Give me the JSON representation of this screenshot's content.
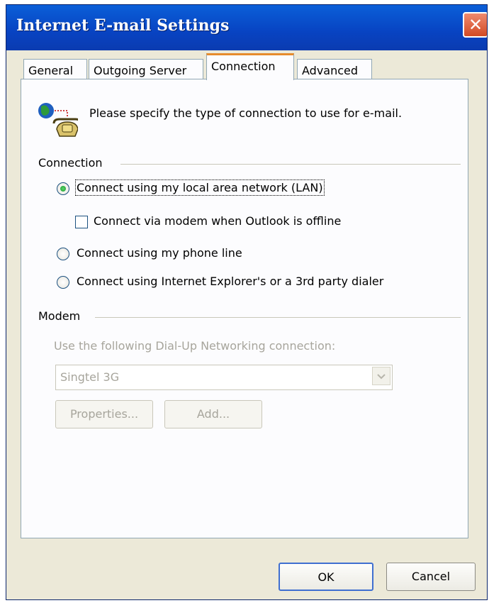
{
  "window": {
    "title": "Internet E-mail Settings"
  },
  "tabs": [
    {
      "label": "General"
    },
    {
      "label": "Outgoing Server"
    },
    {
      "label": "Connection"
    },
    {
      "label": "Advanced"
    }
  ],
  "active_tab": "Connection",
  "intro": {
    "text": "Please specify the type of connection to use for e-mail."
  },
  "connection_group": {
    "label": "Connection",
    "options": [
      {
        "label": "Connect using my local area network (LAN)",
        "selected": true
      },
      {
        "label": "Connect using my phone line",
        "selected": false
      },
      {
        "label": "Connect using Internet Explorer's or a 3rd party dialer",
        "selected": false
      }
    ],
    "modem_checkbox": {
      "label": "Connect via modem when Outlook is offline",
      "checked": false
    }
  },
  "modem_group": {
    "label": "Modem",
    "dialup_label": "Use the following Dial-Up Networking connection:",
    "dialup_value": "Singtel 3G",
    "properties_button": "Properties...",
    "add_button": "Add..."
  },
  "footer": {
    "ok_label": "OK",
    "cancel_label": "Cancel"
  },
  "colors": {
    "title_bar": "#0a5fd8",
    "close_button": "#d24a24",
    "active_tab_accent": "#e68b2c",
    "dialog_bg": "#ece9d8"
  },
  "icons": {
    "close": "close-icon",
    "connection": "globe-phone-icon"
  }
}
